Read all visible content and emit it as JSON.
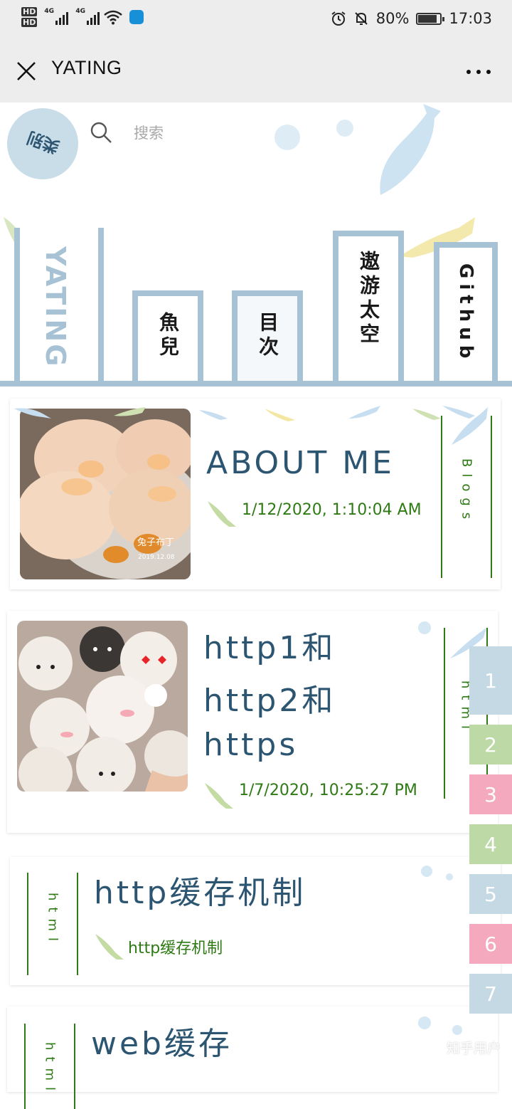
{
  "status_bar": {
    "hd1": "HD",
    "hd2": "HD",
    "net1": "4G",
    "net2": "4G",
    "battery": "80%",
    "time": "17:03"
  },
  "nav": {
    "title": "YATING"
  },
  "logo": {
    "text": "类别"
  },
  "search": {
    "placeholder": "搜索"
  },
  "tabs": {
    "yating": "YATING",
    "fish": "魚兒",
    "menu": "目次",
    "space": "遨游太空",
    "github": "Github"
  },
  "posts": [
    {
      "title": "ABOUT ME",
      "date": "1/12/2020, 1:10:04 AM",
      "tag": "Blogs"
    },
    {
      "title_line1": "http1和",
      "title_line2": "http2和",
      "title_line3": "https",
      "date": "1/7/2020, 10:25:27 PM",
      "tag": "html"
    },
    {
      "title": "http缓存机制",
      "subtitle": "http缓存机制",
      "tag": "html"
    },
    {
      "title": "web缓存",
      "tag": "html"
    }
  ],
  "pagination": [
    {
      "label": "1",
      "color": "#c5d9e4"
    },
    {
      "label": "2",
      "color": "#bcd9a6"
    },
    {
      "label": "3",
      "color": "#f4a9bf"
    },
    {
      "label": "4",
      "color": "#bcd9a6"
    },
    {
      "label": "5",
      "color": "#c5d9e4"
    },
    {
      "label": "6",
      "color": "#f4a9bf"
    },
    {
      "label": "7",
      "color": "#c5d9e4"
    }
  ],
  "watermark": "知乎用户",
  "colors": {
    "accent_blue": "#a7c2d4",
    "title_blue": "#2c5571",
    "tag_green": "#2e7a14",
    "pink": "#f4a9bf",
    "green": "#bcd9a6"
  }
}
